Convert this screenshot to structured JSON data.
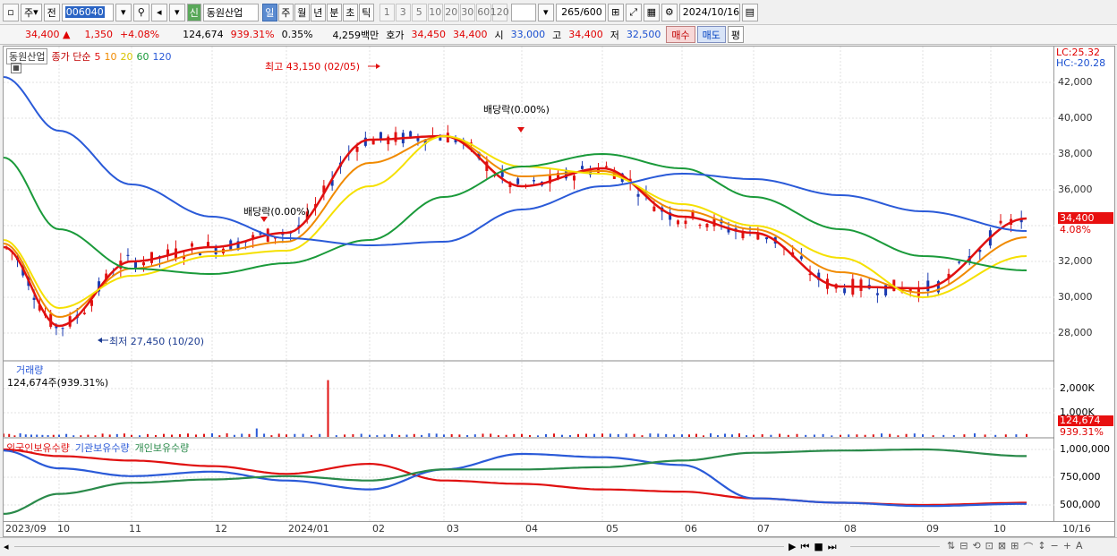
{
  "toolbar": {
    "chart_type": "주",
    "prev": "전",
    "code": "006040",
    "new_badge": "신",
    "stock_name": "동원산업",
    "periods": [
      "일",
      "주",
      "월",
      "년",
      "분",
      "초",
      "틱"
    ],
    "selected_period": "일",
    "intervals": [
      "1",
      "3",
      "5",
      "10",
      "20",
      "30",
      "60",
      "120"
    ],
    "count": "265",
    "count_total": "/600",
    "date": "2024/10/16"
  },
  "info": {
    "price": "34,400",
    "up_arrow": "▲",
    "change": "1,350",
    "change_pct": "+4.08%",
    "volume": "124,674",
    "volume_ratio": "939.31%",
    "turnover": "0.35%",
    "amount": "4,259백만",
    "ask_label": "호가",
    "ask1": "34,450",
    "ask2": "34,400",
    "open_label": "시",
    "open": "33,000",
    "high_label": "고",
    "high": "34,400",
    "low_label": "저",
    "low": "32,500",
    "buy_btn": "매수",
    "sell_btn": "매도",
    "eval_btn": "평"
  },
  "price_panel": {
    "legend_name": "동원산업",
    "legend_ma": "종가 단순",
    "ma_periods": [
      "5",
      "10",
      "20",
      "60",
      "120"
    ],
    "ma_colors": [
      "#e01010",
      "#f08a00",
      "#f5e000",
      "#1a9a3a",
      "#2a5ad8"
    ],
    "annot_high": "최고 43,150 (02/05)",
    "annot_low": "최저 27,450 (10/20)",
    "annot_div1": "배당락(0.00%)",
    "annot_div2": "배당락(0.00%)",
    "lc": "LC:25.32",
    "hc": "HC:-20.28",
    "last_price": "34,400",
    "last_pct": "4.08%",
    "yticks": [
      "42,000",
      "40,000",
      "38,000",
      "36,000",
      "34,000",
      "32,000",
      "30,000",
      "28,000"
    ]
  },
  "volume_panel": {
    "title": "거래량",
    "value": "124,674주(939.31%)",
    "yticks": [
      "2,000K",
      "1,000K"
    ],
    "last_value": "124,674",
    "last_pct": "939.31%"
  },
  "holding_panel": {
    "legend": [
      "외국인보유수량",
      "기관보유수량",
      "개인보유수량"
    ],
    "colors": [
      "#e01010",
      "#2a5ad8",
      "#2a8a4a"
    ],
    "yticks": [
      "1,000,000",
      "750,000",
      "500,000"
    ]
  },
  "xaxis": {
    "labels": [
      "2023/09",
      "10",
      "11",
      "12",
      "2024/01",
      "02",
      "03",
      "04",
      "05",
      "06",
      "07",
      "08",
      "09",
      "10"
    ],
    "right_label": "10/16"
  },
  "chart_data": {
    "type": "line",
    "title": "동원산업",
    "ylim": [
      27000,
      43500
    ],
    "x": [
      "2023/09",
      "10",
      "11",
      "12",
      "2024/01",
      "02",
      "03",
      "04",
      "05",
      "06",
      "07",
      "08",
      "09",
      "10"
    ],
    "series": [
      {
        "name": "종가 단순 5",
        "values": [
          32800,
          28400,
          32000,
          32800,
          33600,
          38800,
          39000,
          36200,
          37200,
          34500,
          33600,
          30600,
          30500,
          34400
        ]
      },
      {
        "name": "종가 단순 20",
        "values": [
          33200,
          29400,
          31200,
          32300,
          32600,
          36200,
          39000,
          37300,
          36900,
          35200,
          34000,
          32200,
          30000,
          32300
        ]
      },
      {
        "name": "종가 단순 60",
        "values": [
          37800,
          33800,
          31600,
          31300,
          31900,
          33200,
          35600,
          37300,
          38000,
          37200,
          35600,
          33800,
          32300,
          31500
        ]
      },
      {
        "name": "종가 단순 120",
        "values": [
          42300,
          39300,
          36300,
          34500,
          33300,
          32900,
          33100,
          34900,
          36200,
          36900,
          36600,
          35700,
          34800,
          33700
        ]
      }
    ],
    "volume_peak": "2024/01 ~2,350K"
  }
}
